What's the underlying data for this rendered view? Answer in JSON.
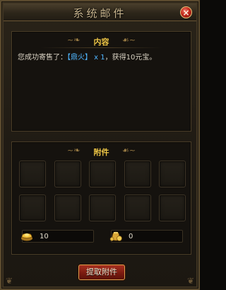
{
  "window": {
    "title": "系统邮件",
    "close_label": "×"
  },
  "content_section": {
    "header": "内容",
    "message": {
      "prefix": "您成功寄售了：",
      "item": "【鼎火】 x 1",
      "suffix": "，获得10元宝。"
    }
  },
  "attachment_section": {
    "header": "附件",
    "slots": [
      {},
      {},
      {},
      {},
      {},
      {},
      {},
      {},
      {},
      {}
    ],
    "currencies": [
      {
        "icon": "gold-ingot-icon",
        "value": "10"
      },
      {
        "icon": "coin-bag-icon",
        "value": "0"
      }
    ]
  },
  "actions": {
    "extract_label": "提取附件"
  },
  "colors": {
    "section_title": "#f2c948",
    "item_link": "#4fb6ff",
    "button_red": "#a8301f"
  }
}
